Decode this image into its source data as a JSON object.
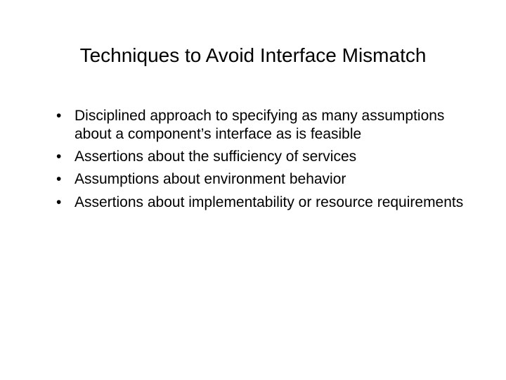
{
  "title": "Techniques to Avoid Interface Mismatch",
  "bullets": [
    "Disciplined approach to specifying as many assumptions about a component’s interface as is feasible",
    "Assertions about the sufficiency of services",
    "Assumptions about environment behavior",
    "Assertions about implementability or resource requirements"
  ]
}
